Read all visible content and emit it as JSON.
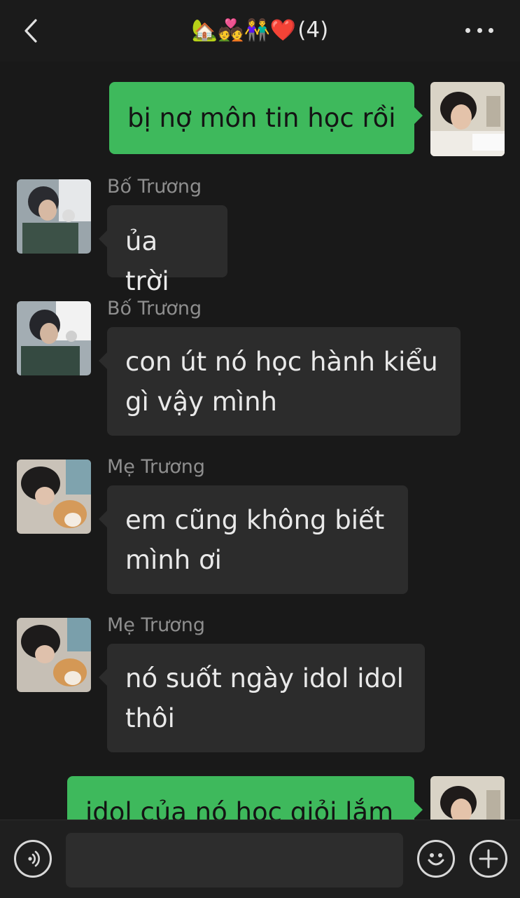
{
  "header": {
    "title_emojis": "🏡💑👫❤️",
    "member_count": "(4)",
    "back_icon": "chevron-left-icon",
    "more_icon": "more-dots-icon"
  },
  "messages": [
    {
      "sender": "me",
      "text": "bị nợ môn tin học rồi"
    },
    {
      "sender": "Bố Trương",
      "text": "ủa trời"
    },
    {
      "sender": "Bố Trương",
      "text": "con út nó học hành kiểu gì vậy mình"
    },
    {
      "sender": "Mẹ Trương",
      "text": "em cũng không biết mình ơi"
    },
    {
      "sender": "Mẹ Trương",
      "text": "nó suốt ngày idol idol thôi"
    },
    {
      "sender": "me",
      "text": "idol của nó học giỏi lắm"
    }
  ],
  "input_bar": {
    "voice_icon": "voice-icon",
    "emoji_icon": "emoji-icon",
    "plus_icon": "plus-icon",
    "input_value": ""
  },
  "colors": {
    "background": "#191919",
    "outgoing_bubble": "#3eb95c",
    "incoming_bubble": "#2c2c2c",
    "sender_name": "#8e8e8e"
  }
}
